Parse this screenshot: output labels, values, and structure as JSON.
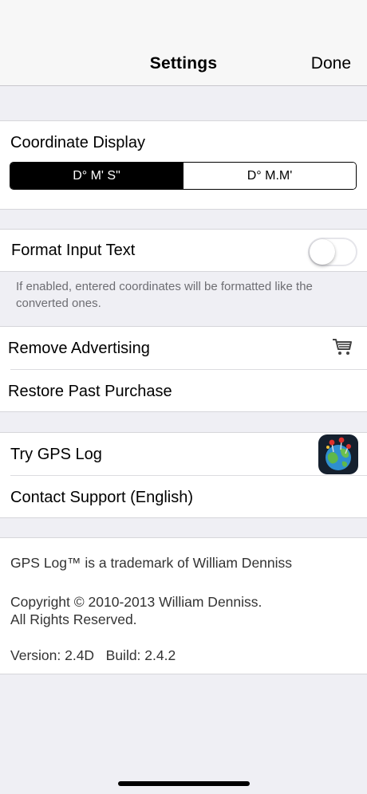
{
  "nav": {
    "title": "Settings",
    "done_label": "Done"
  },
  "coordinate_display": {
    "label": "Coordinate Display",
    "options": [
      "D° M' S\"",
      "D° M.M'"
    ],
    "selected": "D° M' S\""
  },
  "format_input": {
    "label": "Format Input Text",
    "enabled": false,
    "note": "If enabled, entered coordinates will be formatted like the converted ones."
  },
  "purchases": {
    "remove_ads": "Remove Advertising",
    "restore": "Restore Past Purchase"
  },
  "links": {
    "try_gps_log": "Try GPS Log",
    "contact_support": "Contact Support (English)"
  },
  "info": {
    "trademark": "GPS Log™ is a trademark of William Denniss",
    "copyright_line1": "Copyright © 2010-2013 William Denniss.",
    "copyright_line2": "All Rights Reserved.",
    "version": "Version: 2.4D   Build: 2.4.2"
  },
  "colors": {
    "background": "#efeff4",
    "cell": "#ffffff",
    "separator": "#dcdce0",
    "secondary_text": "#6d6d72"
  },
  "icons": {
    "cart": "shopping-cart-icon",
    "gps_log_app": "gps-log-app-icon"
  }
}
